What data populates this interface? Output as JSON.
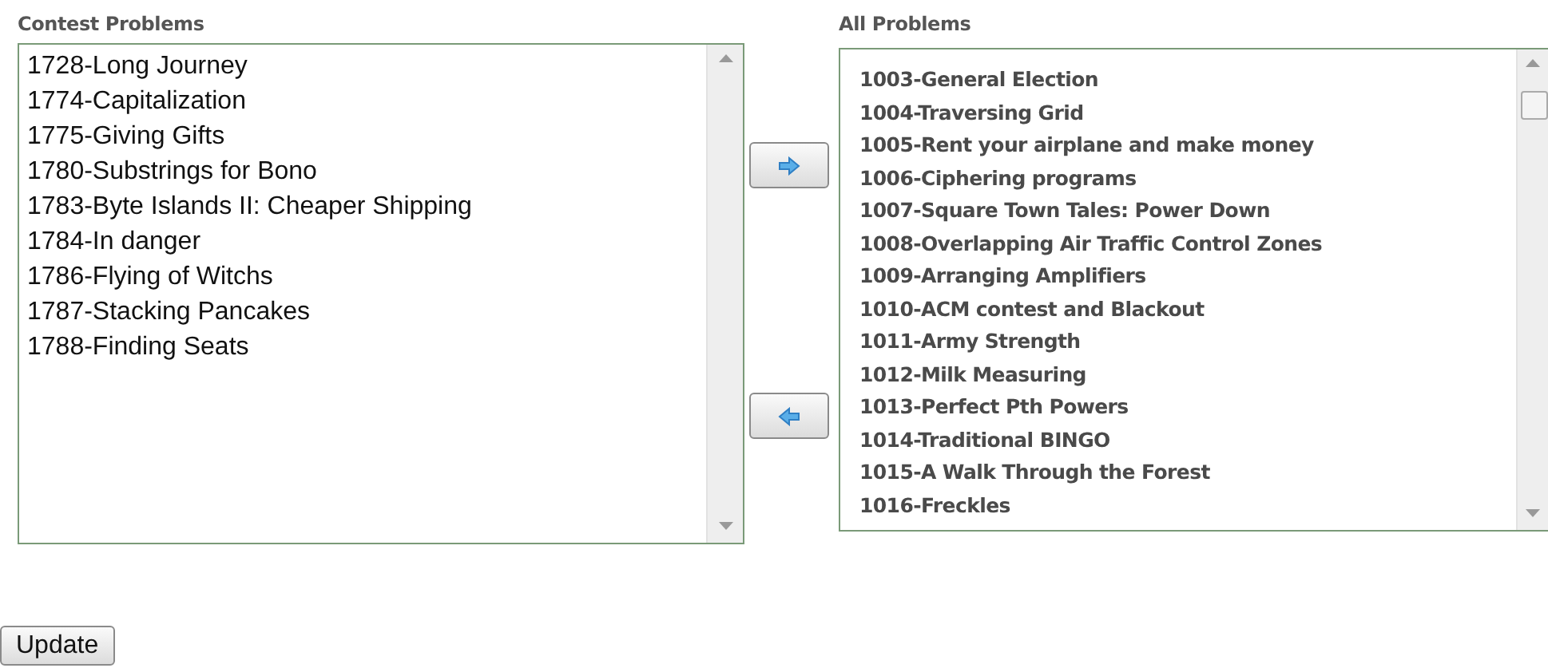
{
  "contest_problems": {
    "label": "Contest Problems",
    "items": [
      "1728-Long Journey",
      "1774-Capitalization",
      "1775-Giving Gifts",
      "1780-Substrings for Bono",
      "1783-Byte Islands II: Cheaper Shipping",
      "1784-In danger",
      "1786-Flying of Witchs",
      "1787-Stacking Pancakes",
      "1788-Finding Seats"
    ]
  },
  "all_problems": {
    "label": "All Problems",
    "items": [
      "1003-General Election",
      "1004-Traversing Grid",
      "1005-Rent your airplane and make money",
      "1006-Ciphering programs",
      "1007-Square Town Tales: Power Down",
      "1008-Overlapping Air Traffic Control Zones",
      "1009-Arranging Amplifiers",
      "1010-ACM contest and Blackout",
      "1011-Army Strength",
      "1012-Milk Measuring",
      "1013-Perfect Pth Powers",
      "1014-Traditional BINGO",
      "1015-A Walk Through the Forest",
      "1016-Freckles"
    ]
  },
  "update_button": "Update"
}
